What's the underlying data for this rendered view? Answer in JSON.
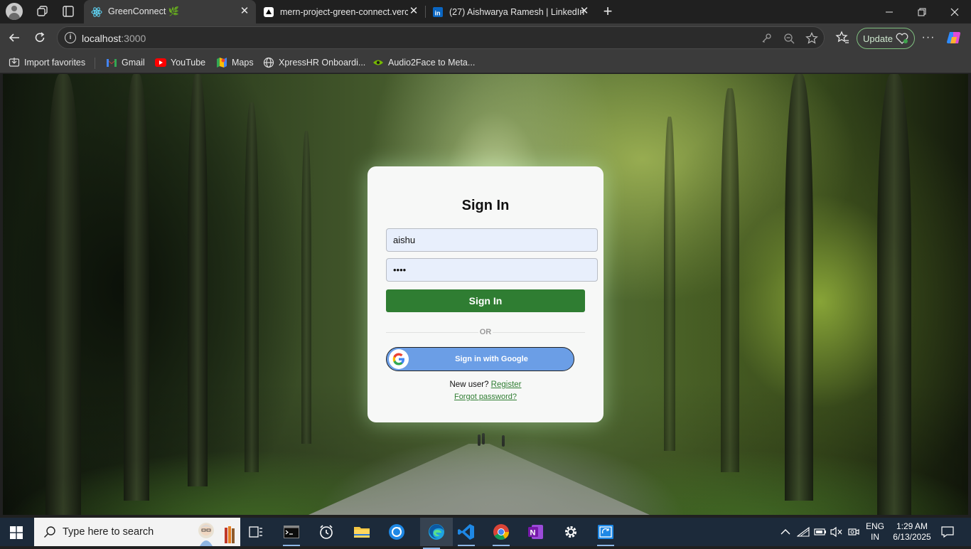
{
  "browser": {
    "tabs": [
      {
        "title": "GreenConnect 🌿",
        "active": true
      },
      {
        "title": "mern-project-green-connect.verc",
        "active": false
      },
      {
        "title": "(27) Aishwarya Ramesh | LinkedIn",
        "active": false
      }
    ],
    "address": {
      "host": "localhost",
      "port": ":3000"
    },
    "update_label": "Update",
    "bookmarks": [
      "Import favorites",
      "Gmail",
      "YouTube",
      "Maps",
      "XpressHR Onboardi...",
      "Audio2Face to Meta..."
    ]
  },
  "signin": {
    "title": "Sign In",
    "username_value": "aishu",
    "password_value": "••••",
    "submit_label": "Sign In",
    "or_text": "OR",
    "google_label": "Sign in with Google",
    "new_user_text": "New user?",
    "register_label": "Register",
    "forgot_label": "Forgot password?",
    "accent_color": "#2f7d32",
    "google_button_color": "#6b9ee6"
  },
  "taskbar": {
    "search_placeholder": "Type here to search",
    "lang_line1": "ENG",
    "lang_line2": "IN",
    "time": "1:29 AM",
    "date": "6/13/2025"
  }
}
